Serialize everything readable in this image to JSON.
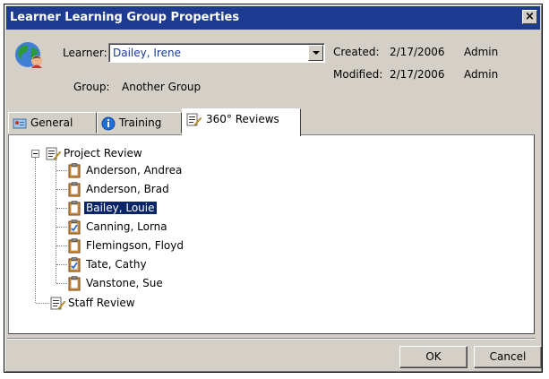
{
  "window": {
    "title": "Learner Learning Group Properties",
    "close_label": "×"
  },
  "header": {
    "learner_label": "Learner:",
    "learner_value": "Dailey, Irene",
    "group_label": "Group:",
    "group_value": "Another Group",
    "created_label": "Created:",
    "created_date": "2/17/2006",
    "created_by": "Admin",
    "modified_label": "Modified:",
    "modified_date": "2/17/2006",
    "modified_by": "Admin"
  },
  "tabs": [
    {
      "label": "General",
      "icon": "card-icon"
    },
    {
      "label": "Training",
      "icon": "info-icon"
    },
    {
      "label": "360° Reviews",
      "icon": "review-icon",
      "active": true
    }
  ],
  "tree": {
    "groups": [
      {
        "label": "Project Review",
        "expanded": true,
        "children": [
          {
            "label": "Anderson, Andrea",
            "checked": false
          },
          {
            "label": "Anderson, Brad",
            "checked": false
          },
          {
            "label": "Bailey, Louie",
            "checked": false,
            "selected": true
          },
          {
            "label": "Canning, Lorna",
            "checked": true
          },
          {
            "label": "Flemingson, Floyd",
            "checked": false
          },
          {
            "label": "Tate, Cathy",
            "checked": true
          },
          {
            "label": "Vanstone, Sue",
            "checked": false
          }
        ]
      },
      {
        "label": "Staff Review",
        "expanded": false,
        "children": []
      }
    ]
  },
  "buttons": {
    "ok": "OK",
    "cancel": "Cancel"
  },
  "colors": {
    "titlebar": "#1d3c91",
    "selection": "#0a246a",
    "face": "#d4d0c8",
    "link_text": "#1a3a9a"
  }
}
